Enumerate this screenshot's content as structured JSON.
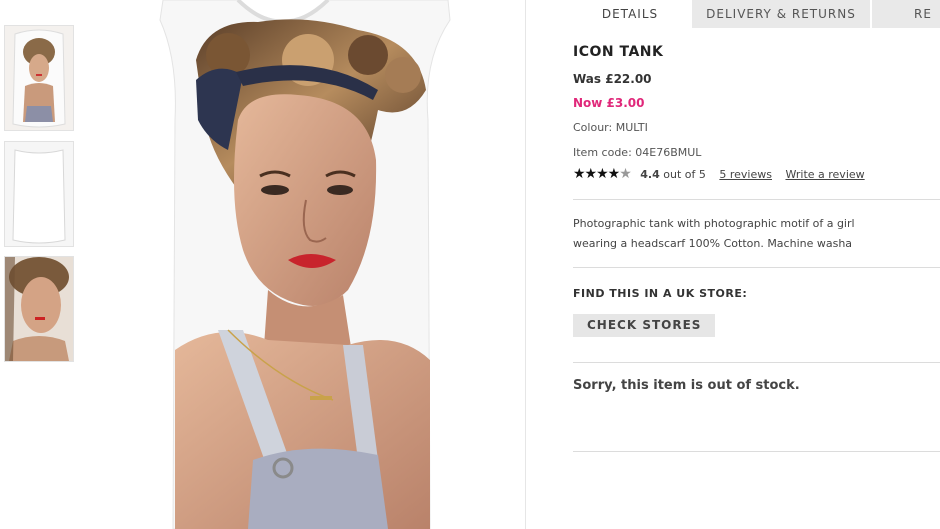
{
  "tabs": [
    {
      "label": "DETAILS"
    },
    {
      "label": "DELIVERY & RETURNS"
    },
    {
      "label": "RE"
    }
  ],
  "product": {
    "title": "ICON TANK",
    "was_price": "Was £22.00",
    "now_price": "Now £3.00",
    "colour": "Colour: MULTI",
    "item_code": "Item code: 04E76BMUL",
    "rating_stars": "★★★★",
    "rating_half": "★",
    "rating_value": 4.4,
    "rating_score": "4.4",
    "rating_text": "out of 5",
    "reviews_link": "5 reviews",
    "write_review_link": "Write a review",
    "description_line1": "Photographic tank with photographic motif of a girl",
    "description_line2": "wearing a headscarf 100% Cotton. Machine washa",
    "find_store_heading": "FIND THIS IN A UK STORE:",
    "check_stores_label": "CHECK STORES",
    "stock_message": "Sorry, this item is out of stock."
  },
  "colors": {
    "sale_price": "#e0287a",
    "tab_inactive": "#e9e9e9",
    "button_bg": "#e6e6e6"
  },
  "thumbnails": [
    {
      "name": "front-print"
    },
    {
      "name": "back-plain"
    },
    {
      "name": "print-closeup"
    }
  ]
}
